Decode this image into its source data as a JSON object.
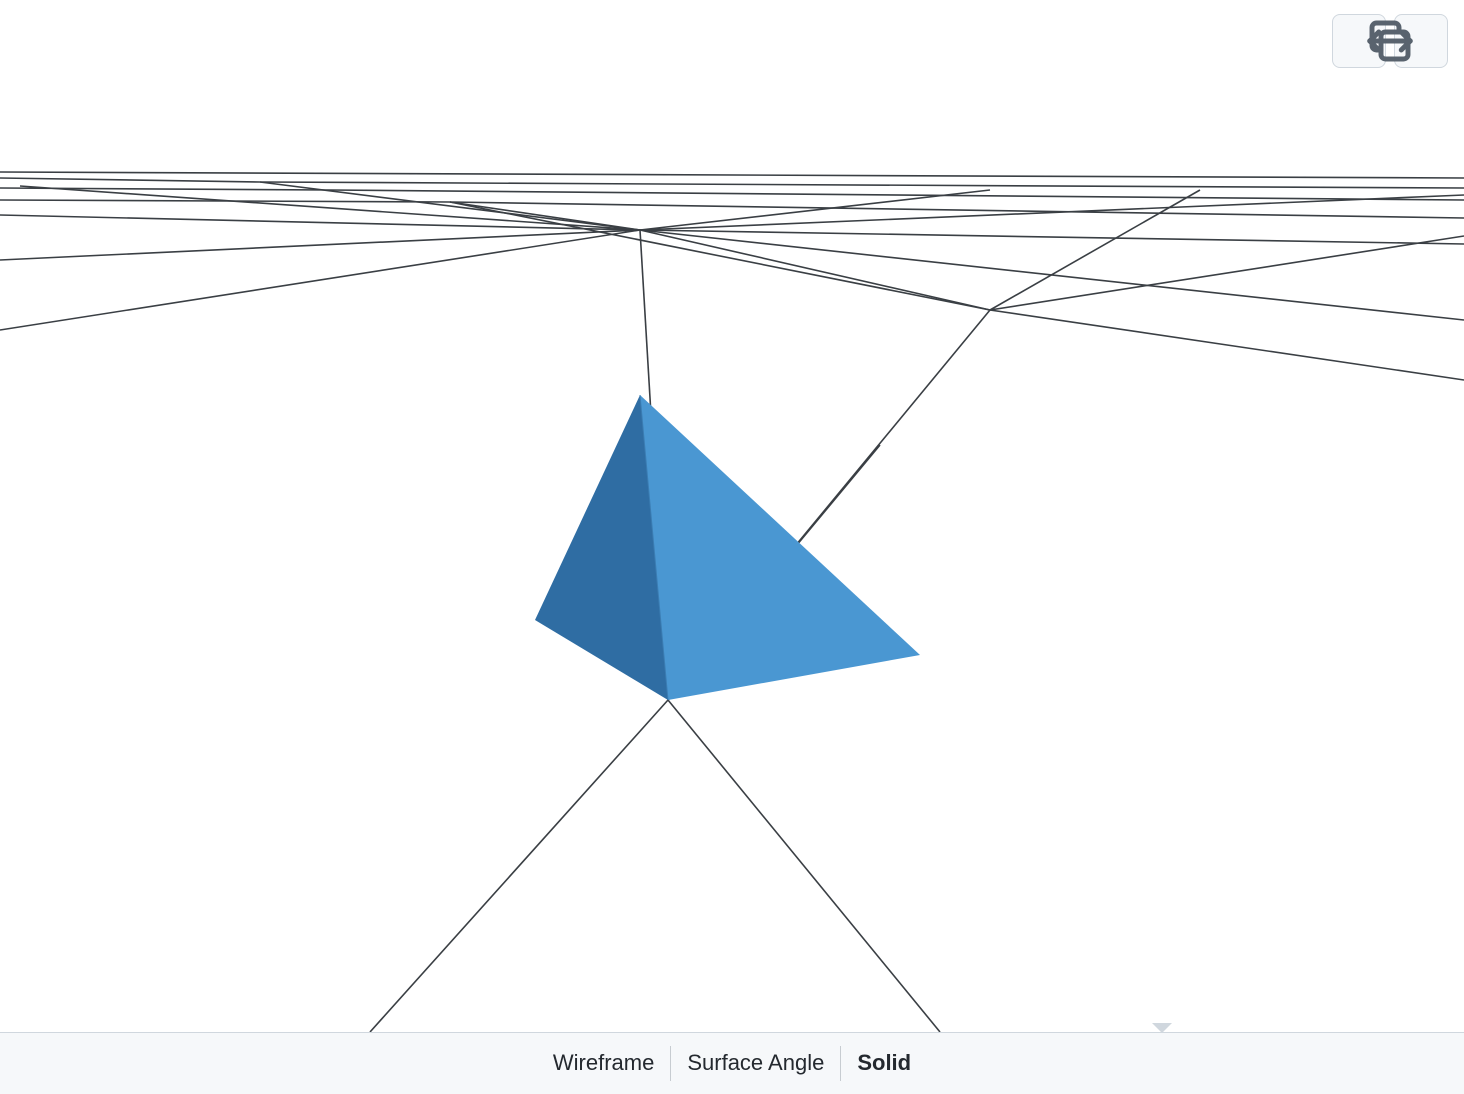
{
  "modes": {
    "wireframe": "Wireframe",
    "surface_angle": "Surface Angle",
    "solid": "Solid",
    "active": "solid"
  },
  "toolbar": {
    "expand_icon": "expand-horizontal-icon",
    "copy_icon": "copy-icon"
  },
  "model": {
    "type": "tetrahedron",
    "color_light": "#4a97d2",
    "color_dark": "#2f6da3",
    "grid_color": "#3a3f44"
  }
}
